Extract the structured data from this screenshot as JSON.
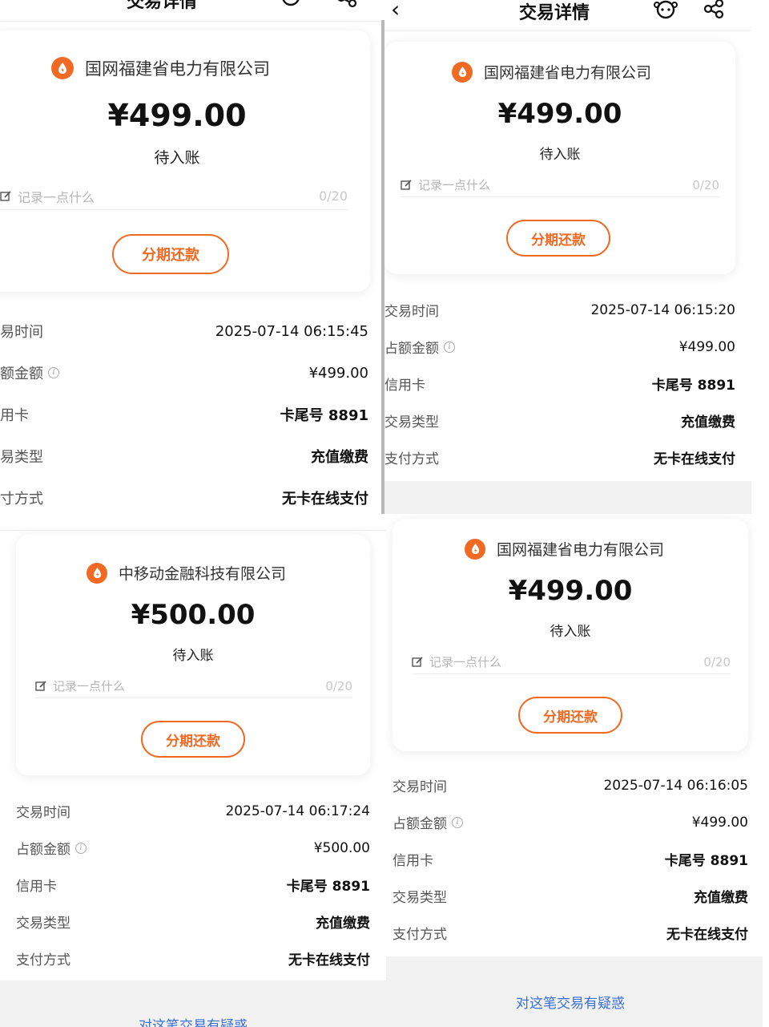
{
  "header": {
    "title": "交易详情"
  },
  "common": {
    "memo_placeholder": "记录一点什么",
    "memo_count": "0/20",
    "installment_button": "分期还款",
    "status": "待入账",
    "labels": {
      "time": "交易时间",
      "amount": "占额金额",
      "card": "信用卡",
      "type": "交易类型",
      "method": "支付方式"
    },
    "labels_cropped_p1": {
      "time": "易时间",
      "amount": "额金额",
      "card": "用卡",
      "type": "易类型",
      "method": "寸方式"
    },
    "labels_cropped_p2": {
      "time": "交易时间",
      "amount": "占额金额",
      "card": "信用卡",
      "type": "交易类型",
      "method": "支付方式"
    },
    "dispute_link": "对这笔交易有疑惑",
    "colors": {
      "accent": "#f06a24",
      "link": "#3a6fd6"
    }
  },
  "screens": [
    {
      "merchant": "国网福建省电力有限公司",
      "amount": "¥499.00",
      "time": "2025-07-14 06:15:45",
      "occupied_amount": "¥499.00",
      "card": "卡尾号 8891",
      "type": "充值缴费",
      "method": "无卡在线支付"
    },
    {
      "merchant": "国网福建省电力有限公司",
      "amount": "¥499.00",
      "time": "2025-07-14 06:15:20",
      "occupied_amount": "¥499.00",
      "card": "卡尾号 8891",
      "type": "充值缴费",
      "method": "无卡在线支付"
    },
    {
      "merchant": "中移动金融科技有限公司",
      "amount": "¥500.00",
      "time": "2025-07-14 06:17:24",
      "occupied_amount": "¥500.00",
      "card": "卡尾号 8891",
      "type": "充值缴费",
      "method": "无卡在线支付"
    },
    {
      "merchant": "国网福建省电力有限公司",
      "amount": "¥499.00",
      "time": "2025-07-14 06:16:05",
      "occupied_amount": "¥499.00",
      "card": "卡尾号 8891",
      "type": "充值缴费",
      "method": "无卡在线支付"
    }
  ]
}
